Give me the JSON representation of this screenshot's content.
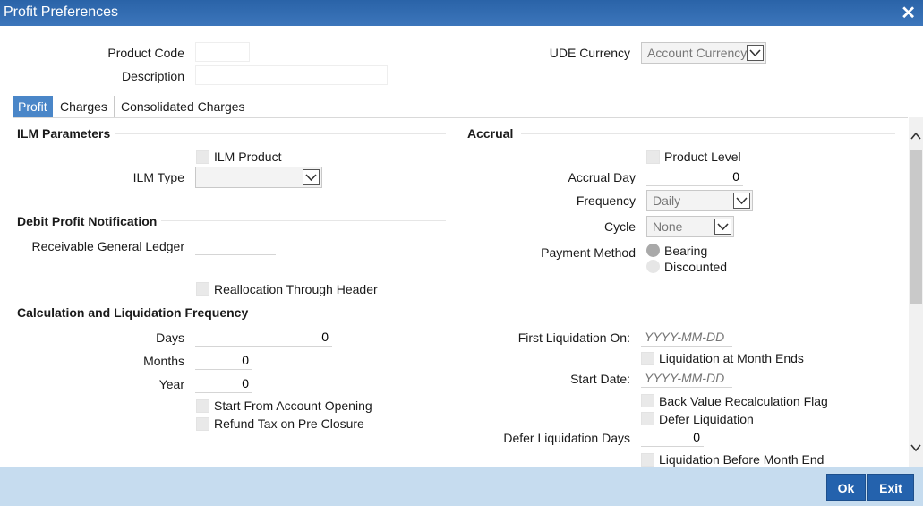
{
  "window": {
    "title": "Profit Preferences",
    "close_glyph": "✕"
  },
  "header": {
    "product_code_label": "Product Code",
    "description_label": "Description",
    "ude_currency_label": "UDE Currency",
    "ude_currency_value": "Account Currency"
  },
  "tabs": [
    {
      "label": "Profit",
      "active": true
    },
    {
      "label": "Charges",
      "active": false
    },
    {
      "label": "Consolidated Charges",
      "active": false
    }
  ],
  "ilm": {
    "section_title": "ILM Parameters",
    "ilm_product_label": "ILM Product",
    "ilm_type_label": "ILM Type",
    "ilm_type_value": ""
  },
  "debit": {
    "section_title": "Debit Profit Notification",
    "receivable_gl_label": "Receivable General Ledger",
    "receivable_gl_value": "",
    "reallocation_label": "Reallocation Through Header"
  },
  "accrual": {
    "section_title": "Accrual",
    "product_level_label": "Product Level",
    "accrual_day_label": "Accrual Day",
    "accrual_day_value": "0",
    "frequency_label": "Frequency",
    "frequency_value": "Daily",
    "cycle_label": "Cycle",
    "cycle_value": "None",
    "payment_method_label": "Payment Method",
    "payment_options": [
      "Bearing",
      "Discounted"
    ],
    "payment_selected": "Bearing"
  },
  "calc": {
    "section_title": "Calculation and Liquidation Frequency",
    "days_label": "Days",
    "days_value": "0",
    "months_label": "Months",
    "months_value": "0",
    "year_label": "Year",
    "year_value": "0",
    "start_from_opening_label": "Start From Account Opening",
    "refund_tax_label": "Refund Tax on Pre Closure",
    "first_liquidation_label": "First Liquidation On:",
    "first_liquidation_placeholder": "YYYY-MM-DD",
    "liq_month_ends_label": "Liquidation at Month Ends",
    "start_date_label": "Start Date:",
    "start_date_placeholder": "YYYY-MM-DD",
    "back_value_label": "Back Value Recalculation Flag",
    "defer_liquidation_label": "Defer Liquidation",
    "defer_days_label": "Defer Liquidation Days",
    "defer_days_value": "0",
    "liq_before_month_end_label": "Liquidation Before Month End"
  },
  "footer": {
    "ok_label": "Ok",
    "exit_label": "Exit"
  },
  "colors": {
    "titlebar": "#2f6aae",
    "accent": "#2462ad",
    "footer": "#c6dcef",
    "active_tab": "#4a86c8"
  }
}
